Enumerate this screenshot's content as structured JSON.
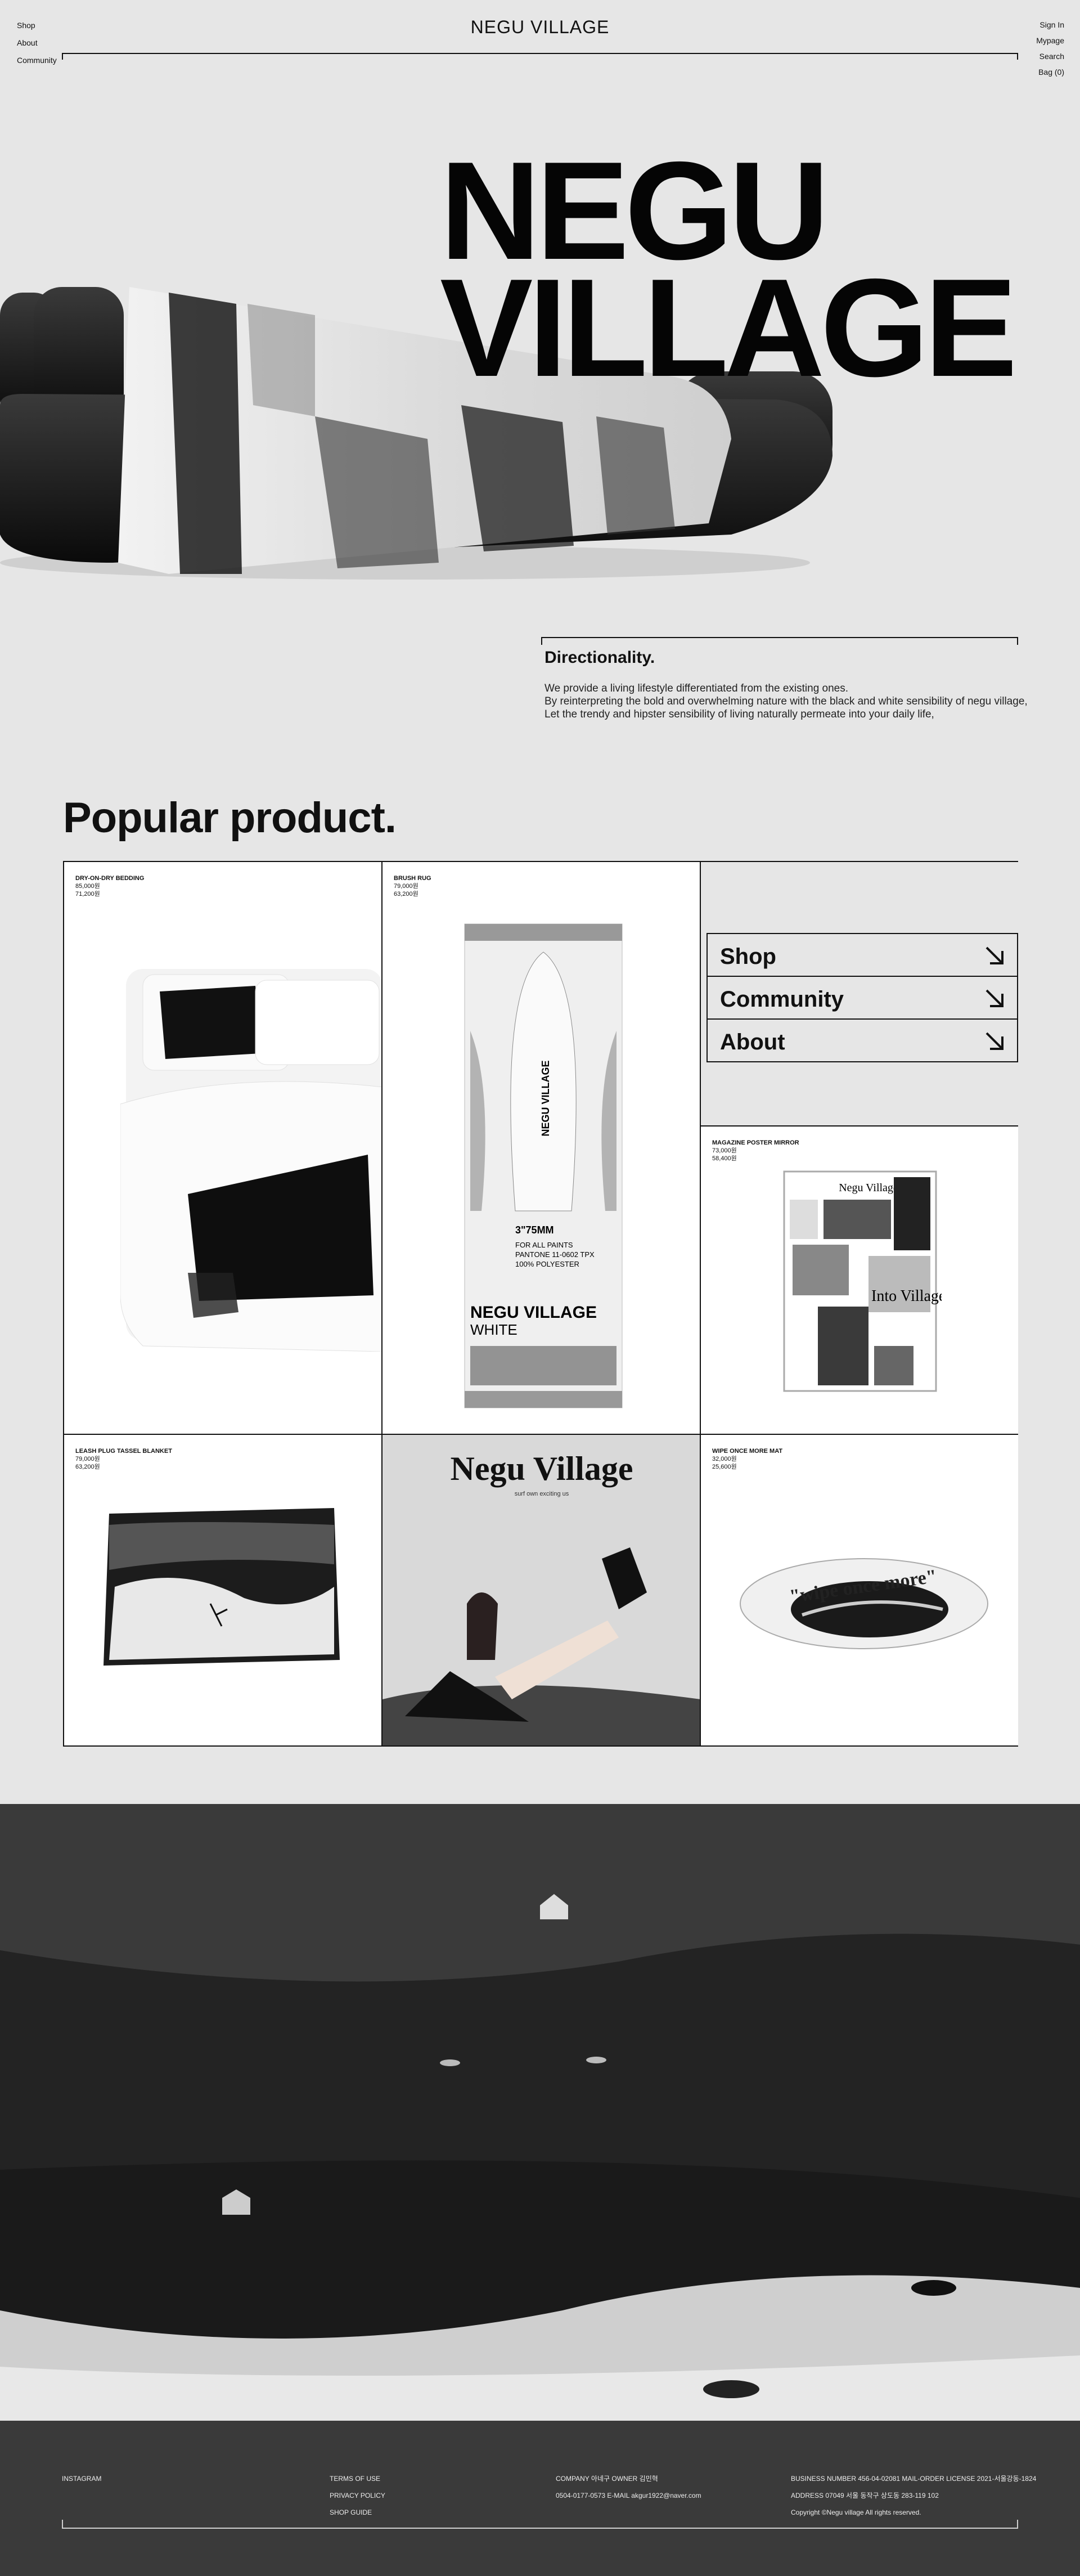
{
  "header": {
    "brand": "NEGU VILLAGE",
    "nav_left": [
      "Shop",
      "About",
      "Community"
    ],
    "nav_right": [
      "Sign In",
      "Mypage",
      "Search",
      "Bag (0)"
    ]
  },
  "hero": {
    "title_line1": "NEGU",
    "title_line2": "VILLAGE"
  },
  "directionality": {
    "title": "Directionality.",
    "lines": [
      "We provide a living lifestyle differentiated from the existing ones.",
      "By reinterpreting the bold and overwhelming nature with the black and white sensibility of negu village,",
      "Let the trendy and hipster sensibility of living naturally permeate into your daily life,"
    ]
  },
  "popular": {
    "title": "Popular product.",
    "products": [
      {
        "name": "DRY-ON-DRY BEDDING",
        "old_price": "85,000원",
        "price": "71,200원"
      },
      {
        "name": "BRUSH RUG",
        "old_price": "79,000원",
        "price": "63,200원"
      },
      {
        "name": "MAGAZINE POSTER MIRROR",
        "old_price": "73,000원",
        "price": "58,400원"
      },
      {
        "name": "LEASH PLUG TASSEL BLANKET",
        "old_price": "79,000원",
        "price": "63,200원"
      },
      {
        "name": "WIPE ONCE MORE MAT",
        "old_price": "32,000원",
        "price": "25,600원"
      }
    ],
    "menu": [
      "Shop",
      "Community",
      "About"
    ],
    "rug_text": {
      "brand": "NEGU VILLAGE",
      "size": "3\"75MM",
      "l1": "FOR ALL PAINTS",
      "l2": "PANTONE 11-0602 TPX",
      "l3": "100% POLYESTER",
      "bottom1": "NEGU VILLAGE",
      "bottom2": "WHITE"
    },
    "poster_text": {
      "masthead": "Negu Village",
      "sub": "Negu village",
      "cover": "Into Village"
    },
    "magazine_text": {
      "masthead": "Negu Village",
      "sub": "surf own exciting us"
    },
    "mat_text": {
      "main": "\"wipe once more\""
    }
  },
  "footer": {
    "col1": [
      "INSTAGRAM"
    ],
    "col2": [
      "TERMS OF USE",
      "PRIVACY POLICY",
      "SHOP GUIDE"
    ],
    "col3": [
      "COMPANY 아네구   OWNER 김민혁",
      "0504-0177-0573   E-MAIL akgur1922@naver.com"
    ],
    "col4": [
      "BUSINESS NUMBER 456-04-02081   MAIL-ORDER LICENSE 2021-서울강동-1824",
      "ADDRESS 07049 서울 동작구 상도동 283-119 102",
      "Copyright ©Negu village All rights reserved."
    ]
  },
  "colors": {
    "bg": "#e6e6e6",
    "ink": "#111111",
    "footer": "#3a3a3a"
  },
  "icons": {
    "menu_arrow": "arrow-down-right-icon"
  }
}
